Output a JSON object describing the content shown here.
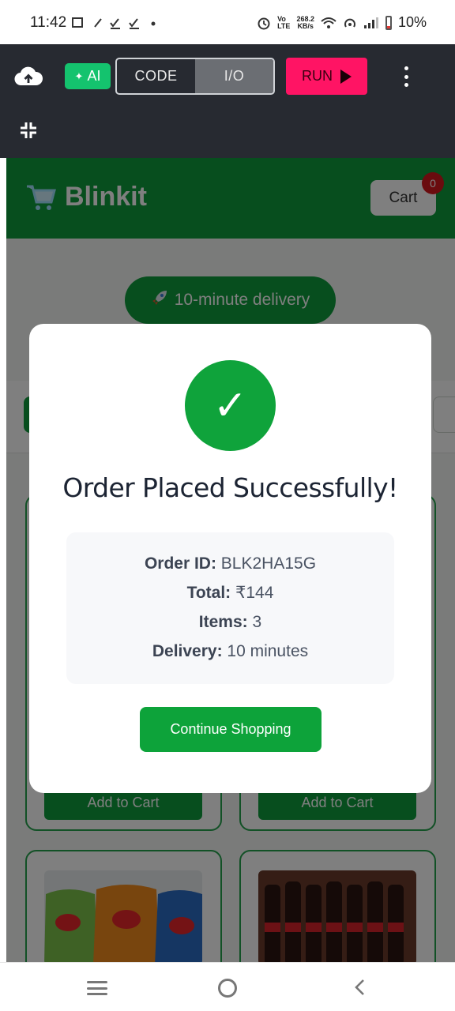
{
  "status_bar": {
    "time": "11:42",
    "net_top": "268.2",
    "net_bottom": "KB/s",
    "battery": "10%"
  },
  "editor": {
    "ai_label": "AI",
    "tabs": [
      {
        "label": "CODE",
        "active": false
      },
      {
        "label": "I/O",
        "active": true
      }
    ],
    "run_label": "RUN",
    "accent_run": "#ff1464",
    "accent_ai": "#14c36e"
  },
  "app": {
    "brand_name": "Blinkit",
    "cart_label": "Cart",
    "cart_count": "0",
    "delivery_pill": "10-minute delivery",
    "add_to_cart_label": "Add to Cart",
    "brand_color": "#0f9d3c"
  },
  "modal": {
    "title": "Order Placed Successfully!",
    "details": [
      {
        "label": "Order ID:",
        "value": "BLK2HA15G"
      },
      {
        "label": "Total:",
        "value": "₹144"
      },
      {
        "label": "Items:",
        "value": "3"
      },
      {
        "label": "Delivery:",
        "value": "10 minutes"
      }
    ],
    "continue_label": "Continue Shopping"
  }
}
